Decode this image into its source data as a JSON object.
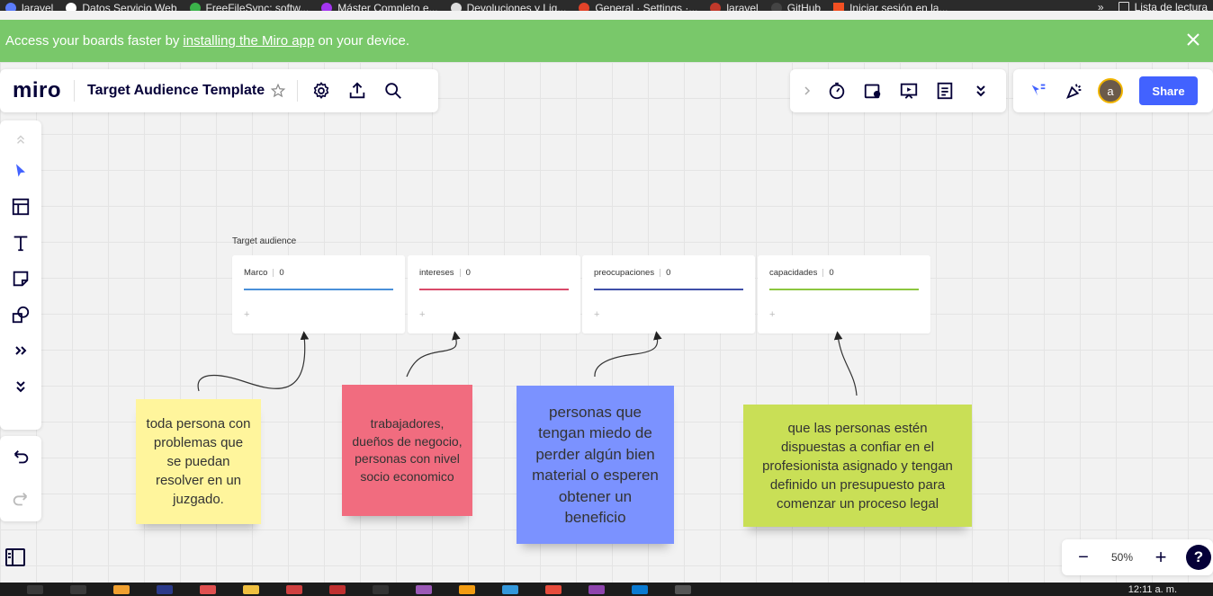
{
  "bookmarks": [
    {
      "label": "laravel",
      "color": "#5b7cfa"
    },
    {
      "label": "Datos Servicio Web",
      "color": "#ffffff"
    },
    {
      "label": "FreeFileSync: softw...",
      "color": "#3bb34a"
    },
    {
      "label": "Máster Completo e...",
      "color": "#a435f0"
    },
    {
      "label": "Devoluciones y Liq...",
      "color": "#dddddd"
    },
    {
      "label": "General · Settings ·...",
      "color": "#e24329"
    },
    {
      "label": "laravel",
      "color": "#c0392b"
    },
    {
      "label": "GitHub",
      "color": "#444444"
    },
    {
      "label": "Iniciar sesión en la...",
      "color": "#f25022"
    }
  ],
  "bookmarks_more": "»",
  "reading_list": "Lista de lectura",
  "banner": {
    "prefix": "Access your boards faster by",
    "link": "installing the Miro app",
    "suffix": "on your device."
  },
  "header": {
    "logo": "miro",
    "board_title": "Target Audience Template",
    "share_label": "Share",
    "avatar_letter": "a"
  },
  "frame_label": "Target audience",
  "columns": [
    {
      "title": "Marco",
      "count": "0",
      "color": "#4a90d9"
    },
    {
      "title": "intereses",
      "count": "0",
      "color": "#d94a6a"
    },
    {
      "title": "preocupaciones",
      "count": "0",
      "color": "#3f4fa8"
    },
    {
      "title": "capacidades",
      "count": "0",
      "color": "#8cc63f"
    }
  ],
  "column_add": "+",
  "stickies": [
    {
      "text": "toda persona con problemas que se puedan resolver en un juzgado.",
      "color": "#fff59c"
    },
    {
      "text": "trabajadores, dueños de negocio, personas con nivel socio economico",
      "color": "#f16c7f"
    },
    {
      "text": "personas que tengan miedo de perder algún bien material o esperen obtener un beneficio",
      "color": "#7b92ff"
    },
    {
      "text": "que las personas estén dispuestas a confiar en el profesionista  asignado y tengan definido un presupuesto para comenzar un proceso legal",
      "color": "#c9df56"
    }
  ],
  "zoom": {
    "minus": "−",
    "value": "50%",
    "plus": "+",
    "help": "?"
  },
  "taskbar_time": "12:11 a. m."
}
